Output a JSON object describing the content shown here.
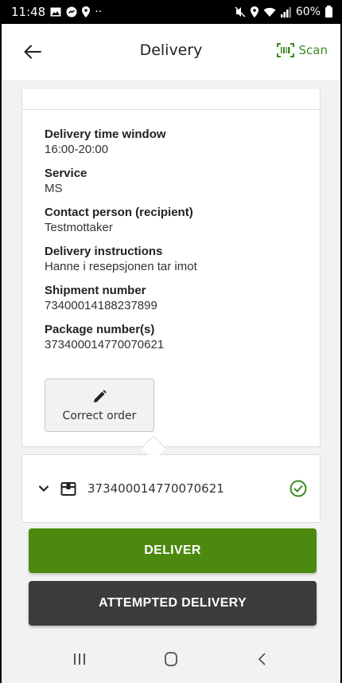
{
  "status_bar": {
    "time": "11:48",
    "extra": "··",
    "battery": "60%",
    "icons": [
      "gallery-icon",
      "messenger-icon",
      "location-icon",
      "mute-icon",
      "location-icon",
      "wifi-icon",
      "signal-icon",
      "battery-icon"
    ]
  },
  "header": {
    "title": "Delivery",
    "scan_label": "Scan",
    "accent_color": "#3a8a1e"
  },
  "details": [
    {
      "label": "Delivery time window",
      "value": "16:00-20:00"
    },
    {
      "label": "Service",
      "value": "MS"
    },
    {
      "label": "Contact person (recipient)",
      "value": "Testmottaker"
    },
    {
      "label": "Delivery instructions",
      "value": "Hanne i resepsjonen tar imot"
    },
    {
      "label": "Shipment number",
      "value": "73400014188237899"
    },
    {
      "label": "Package number(s)",
      "value": "373400014770070621"
    }
  ],
  "correct_order_label": "Correct order",
  "package": {
    "number": "373400014770070621",
    "status": "checked"
  },
  "actions": {
    "deliver_label": "DELIVER",
    "deliver_color": "#4c8a0f",
    "attempted_label": "ATTEMPTED DELIVERY",
    "attempted_color": "#3c3c3c"
  },
  "nav": [
    "recent-apps-icon",
    "home-icon",
    "back-nav-icon"
  ]
}
